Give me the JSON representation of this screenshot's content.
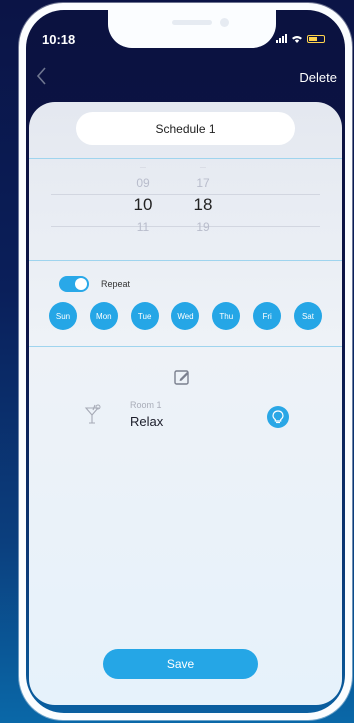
{
  "status_bar": {
    "time": "10:18"
  },
  "nav": {
    "back_icon": "chevron-left-icon",
    "delete_label": "Delete"
  },
  "schedule": {
    "name": "Schedule 1"
  },
  "time_picker": {
    "hours": {
      "above": "09",
      "selected": "10",
      "below": "11"
    },
    "minutes": {
      "above": "17",
      "selected": "18",
      "below": "19"
    }
  },
  "repeat": {
    "label": "Repeat",
    "enabled": true
  },
  "days": [
    "Sun",
    "Mon",
    "Tue",
    "Wed",
    "Thu",
    "Fri",
    "Sat"
  ],
  "edit_icon": "edit-icon",
  "scene": {
    "room": "Room 1",
    "name": "Relax",
    "icon": "cocktail-icon",
    "action_icon": "bulb-icon"
  },
  "save_label": "Save",
  "colors": {
    "accent": "#25a6e6",
    "background": "#0b1446",
    "card": "#eef2f7"
  }
}
